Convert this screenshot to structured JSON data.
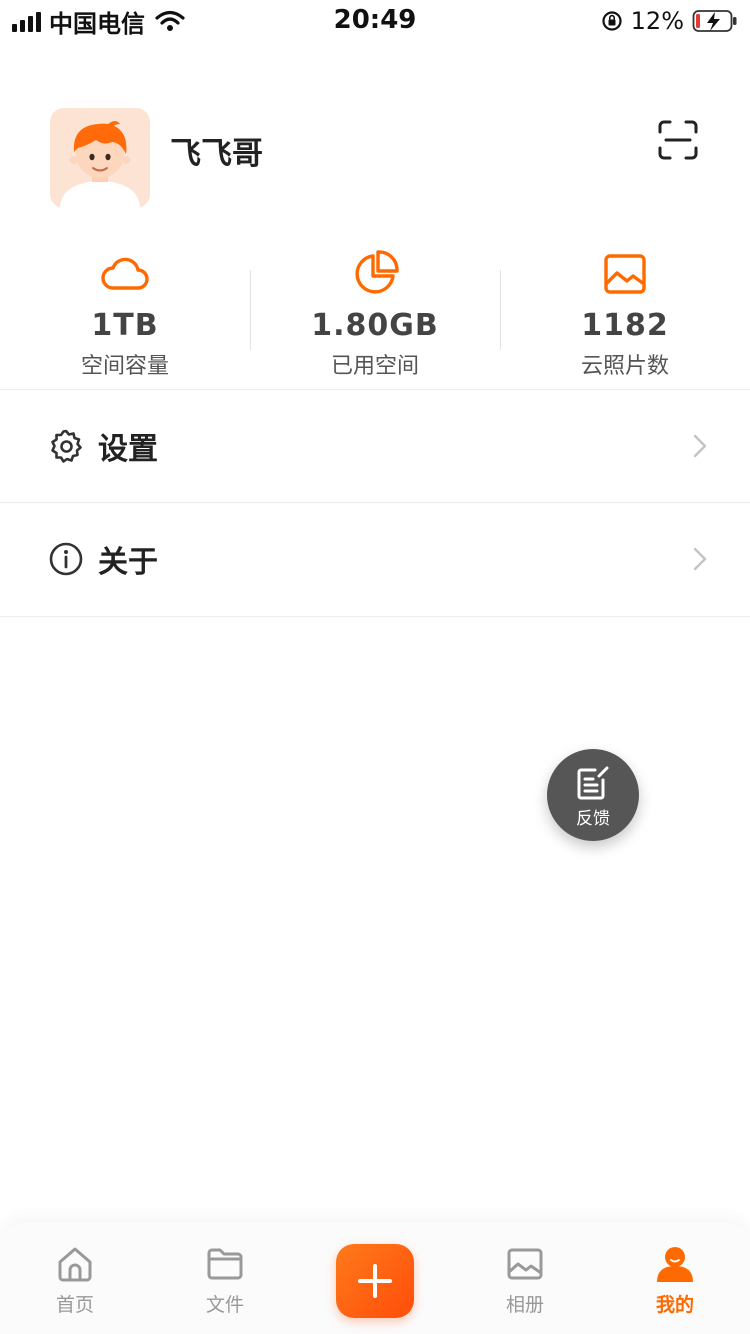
{
  "status_bar": {
    "carrier": "中国电信",
    "time": "20:49",
    "battery": "12%"
  },
  "profile": {
    "username": "飞飞哥"
  },
  "stats": [
    {
      "icon": "cloud-icon",
      "value": "1TB",
      "label": "空间容量"
    },
    {
      "icon": "pie-chart-icon",
      "value": "1.80GB",
      "label": "已用空间"
    },
    {
      "icon": "image-icon",
      "value": "1182",
      "label": "云照片数"
    }
  ],
  "menu": [
    {
      "icon": "gear-icon",
      "label": "设置"
    },
    {
      "icon": "info-icon",
      "label": "关于"
    }
  ],
  "feedback": {
    "label": "反馈"
  },
  "tabs": [
    {
      "icon": "home-icon",
      "label": "首页",
      "active": false
    },
    {
      "icon": "folder-icon",
      "label": "文件",
      "active": false
    },
    {
      "icon": "plus-icon",
      "label": "",
      "active": false
    },
    {
      "icon": "photo-album-icon",
      "label": "相册",
      "active": false
    },
    {
      "icon": "user-icon",
      "label": "我的",
      "active": true
    }
  ],
  "colors": {
    "accent": "#ff6a00",
    "tab_inactive": "#999999",
    "fab_background": "#565656"
  }
}
